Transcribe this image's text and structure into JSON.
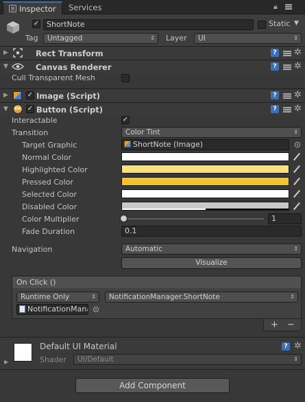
{
  "tabs": {
    "inspector": "Inspector",
    "services": "Services"
  },
  "header": {
    "name": "ShortNote",
    "active_check": "✓",
    "static_label": "Static",
    "tag_label": "Tag",
    "tag_value": "Untagged",
    "layer_label": "Layer",
    "layer_value": "UI"
  },
  "components": {
    "rect_transform": "Rect Transform",
    "canvas_renderer": "Canvas Renderer",
    "cull_label": "Cull Transparent Mesh",
    "image_script": "Image (Script)",
    "button_script": "Button (Script)",
    "check": "✓"
  },
  "button": {
    "interactable_label": "Interactable",
    "transition_label": "Transition",
    "transition_value": "Color Tint",
    "target_graphic_label": "Target Graphic",
    "target_graphic_value": "ShortNote (Image)",
    "normal_color_label": "Normal Color",
    "highlighted_color_label": "Highlighted Color",
    "pressed_color_label": "Pressed Color",
    "selected_color_label": "Selected Color",
    "disabled_color_label": "Disabled Color",
    "color_multiplier_label": "Color Multiplier",
    "color_multiplier_value": "1",
    "fade_duration_label": "Fade Duration",
    "fade_duration_value": "0.1",
    "navigation_label": "Navigation",
    "navigation_value": "Automatic",
    "visualize_label": "Visualize"
  },
  "colors": {
    "normal": "#ffffff",
    "highlighted": "#f9e07a",
    "pressed": "#f2c42e",
    "selected": "#ffffff",
    "disabled": "#c8c8c8",
    "accent": "#3c6fb5"
  },
  "onclick": {
    "title": "On Click ()",
    "runtime_value": "Runtime Only",
    "function_value": "NotificationManager.ShortNote",
    "object_value": "NotificationMana",
    "add": "+",
    "remove": "−"
  },
  "material": {
    "name": "Default UI Material",
    "shader_label": "Shader",
    "shader_value": "UI/Default"
  },
  "add_component_label": "Add Component",
  "icons": {
    "help": "?",
    "tab_menu_arrow": "▾",
    "lock": "🔒",
    "fold_right": "▶",
    "fold_down": "▼",
    "dropdown_arrow": "▾",
    "updown": "⇕"
  }
}
